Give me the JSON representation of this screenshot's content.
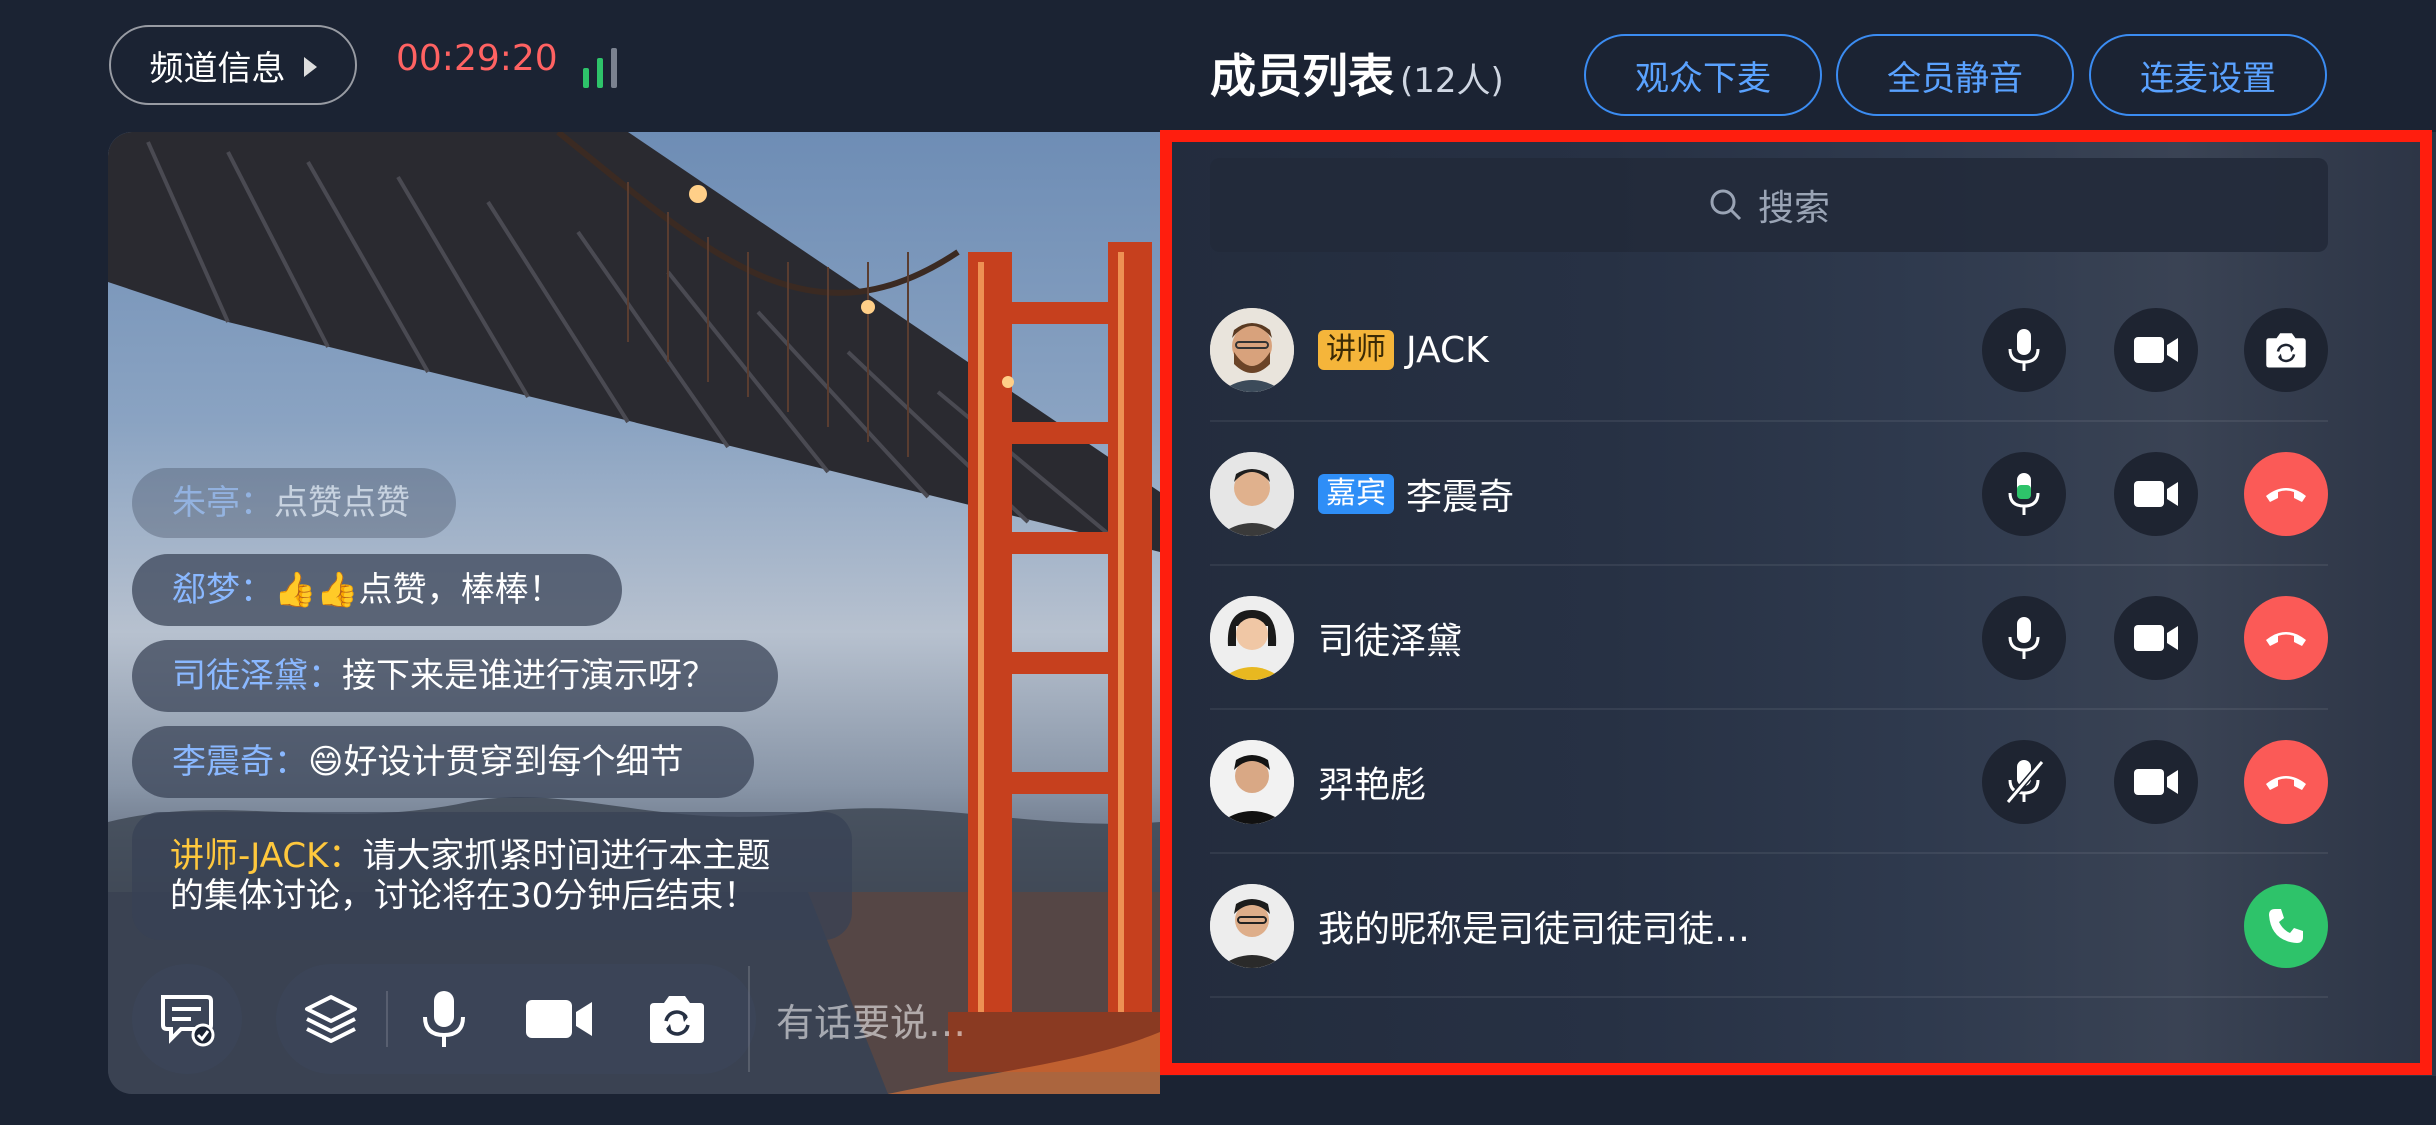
{
  "topbar": {
    "channel_info": "频道信息",
    "timer": "00:29:20"
  },
  "chat": {
    "messages": [
      {
        "nick": "朱亭：",
        "text": "点赞点赞"
      },
      {
        "nick": "郄梦：",
        "text": "👍👍点赞，棒棒！"
      },
      {
        "nick": "司徒泽黛：",
        "text": "接下来是谁进行演示呀？"
      },
      {
        "nick": "李震奇：",
        "text": "😄好设计贯穿到每个细节"
      },
      {
        "nick": "讲师-JACK：",
        "text": "请大家抓紧时间进行本主题",
        "text2": "的集体讨论，讨论将在30分钟后结束！"
      }
    ],
    "input_placeholder": "有话要说…"
  },
  "members": {
    "title": "成员列表",
    "count": "(12人)",
    "buttons": [
      "观众下麦",
      "全员静音",
      "连麦设置"
    ],
    "search_placeholder": "搜索",
    "list": [
      {
        "role": "讲师",
        "name": "JACK"
      },
      {
        "role": "嘉宾",
        "name": "李震奇"
      },
      {
        "role": "",
        "name": "司徒泽黛"
      },
      {
        "role": "",
        "name": "羿艳彪"
      },
      {
        "role": "",
        "name": "我的昵称是司徒司徒司徒…"
      }
    ]
  },
  "colors": {
    "timer": "#ff6262",
    "accent_blue": "#3b8cf2",
    "hangup_red": "#fb5a57",
    "call_green": "#2ec36a",
    "teacher_badge": "#f5b53a",
    "guest_badge": "#2e8ef7",
    "highlight_frame": "#ff1e0e",
    "signal_active": "#2ec36a"
  }
}
